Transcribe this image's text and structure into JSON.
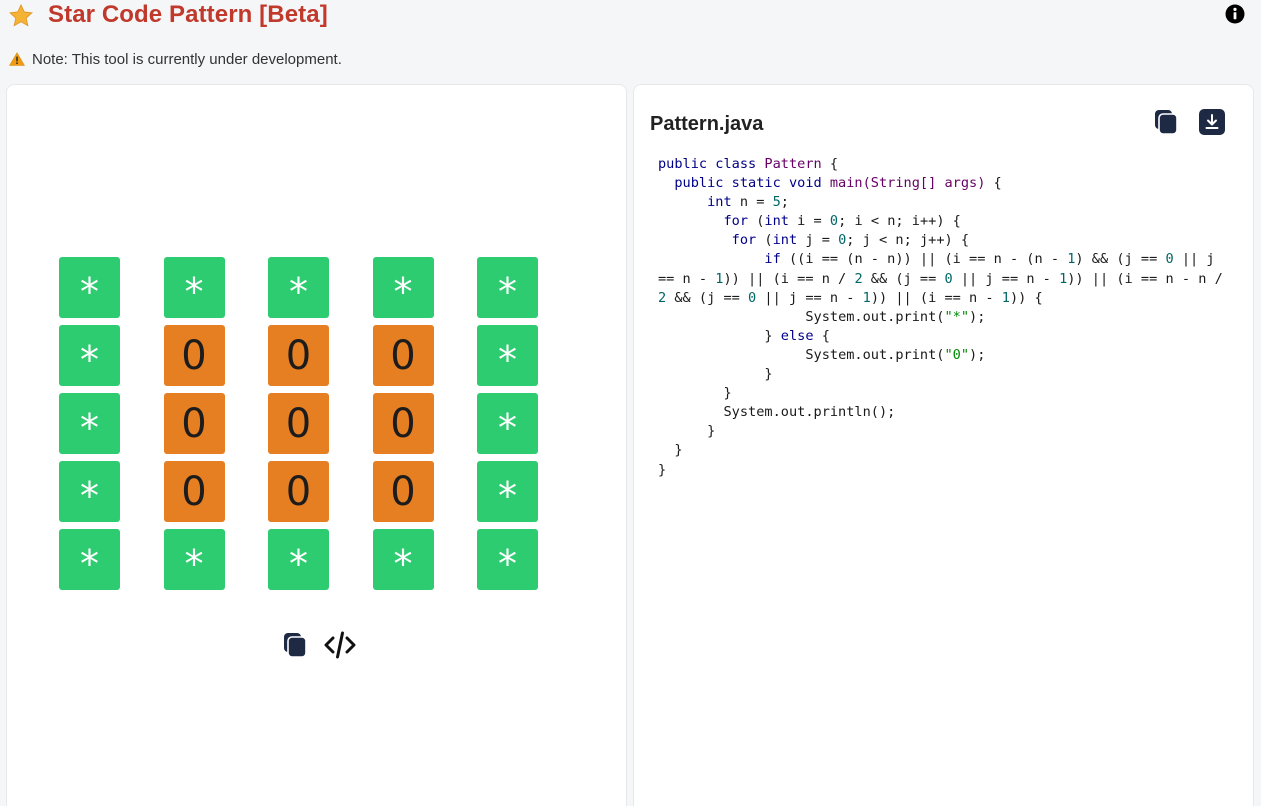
{
  "header": {
    "title": "Star Code Pattern [Beta]",
    "star_icon": "star-icon",
    "info_icon": "info-icon"
  },
  "note": {
    "text": "Note: This tool is currently under development.",
    "icon": "warning-icon"
  },
  "pattern": {
    "rows": [
      [
        "*",
        "*",
        "*",
        "*",
        "*"
      ],
      [
        "*",
        "0",
        "0",
        "0",
        "*"
      ],
      [
        "*",
        "0",
        "0",
        "0",
        "*"
      ],
      [
        "*",
        "0",
        "0",
        "0",
        "*"
      ],
      [
        "*",
        "*",
        "*",
        "*",
        "*"
      ]
    ],
    "star_color": "#2ecc71",
    "zero_color": "#e67e22"
  },
  "left_actions": {
    "copy_icon": "copy-icon",
    "code_icon": "code-icon"
  },
  "code_panel": {
    "filename": "Pattern.java",
    "copy_icon": "copy-icon",
    "download_icon": "download-icon",
    "lines": [
      [
        {
          "t": "public class ",
          "c": "kw"
        },
        {
          "t": "Pattern",
          "c": "cls"
        },
        {
          "t": " {",
          "c": ""
        }
      ],
      [
        {
          "t": "  public static void ",
          "c": "kw"
        },
        {
          "t": "main(String[] args)",
          "c": "cls"
        },
        {
          "t": " {",
          "c": ""
        }
      ],
      [
        {
          "t": "      int ",
          "c": "kw"
        },
        {
          "t": "n = ",
          "c": ""
        },
        {
          "t": "5",
          "c": "num"
        },
        {
          "t": ";",
          "c": ""
        }
      ],
      [
        {
          "t": "        for ",
          "c": "kw"
        },
        {
          "t": "(",
          "c": ""
        },
        {
          "t": "int ",
          "c": "kw"
        },
        {
          "t": "i = ",
          "c": ""
        },
        {
          "t": "0",
          "c": "num"
        },
        {
          "t": "; i < n; i++) {",
          "c": ""
        }
      ],
      [
        {
          "t": "         for ",
          "c": "kw"
        },
        {
          "t": "(",
          "c": ""
        },
        {
          "t": "int ",
          "c": "kw"
        },
        {
          "t": "j = ",
          "c": ""
        },
        {
          "t": "0",
          "c": "num"
        },
        {
          "t": "; j < n; j++) {",
          "c": ""
        }
      ],
      [
        {
          "t": "             if ",
          "c": "kw"
        },
        {
          "t": "((i == (n - n)) || (i == n - (n - ",
          "c": ""
        },
        {
          "t": "1",
          "c": "num"
        },
        {
          "t": ") && (j == ",
          "c": ""
        },
        {
          "t": "0",
          "c": "num"
        },
        {
          "t": " || j == n - ",
          "c": ""
        },
        {
          "t": "1",
          "c": "num"
        },
        {
          "t": ")) || (i == n / ",
          "c": ""
        },
        {
          "t": "2",
          "c": "num"
        },
        {
          "t": " && (j == ",
          "c": ""
        },
        {
          "t": "0",
          "c": "num"
        },
        {
          "t": " || j == n - ",
          "c": ""
        },
        {
          "t": "1",
          "c": "num"
        },
        {
          "t": ")) || (i == n - n / ",
          "c": ""
        },
        {
          "t": "2",
          "c": "num"
        },
        {
          "t": " && (j == ",
          "c": ""
        },
        {
          "t": "0",
          "c": "num"
        },
        {
          "t": " || j == n - ",
          "c": ""
        },
        {
          "t": "1",
          "c": "num"
        },
        {
          "t": ")) || (i == n - ",
          "c": ""
        },
        {
          "t": "1",
          "c": "num"
        },
        {
          "t": ")) {",
          "c": ""
        }
      ],
      [
        {
          "t": "                  System.out.print(",
          "c": ""
        },
        {
          "t": "\"*\"",
          "c": "str"
        },
        {
          "t": ");",
          "c": ""
        }
      ],
      [
        {
          "t": "             } ",
          "c": ""
        },
        {
          "t": "else",
          "c": "kw"
        },
        {
          "t": " {",
          "c": ""
        }
      ],
      [
        {
          "t": "                  System.out.print(",
          "c": ""
        },
        {
          "t": "\"0\"",
          "c": "str"
        },
        {
          "t": ");",
          "c": ""
        }
      ],
      [
        {
          "t": "             }",
          "c": ""
        }
      ],
      [
        {
          "t": "        }",
          "c": ""
        }
      ],
      [
        {
          "t": "        System.out.println();",
          "c": ""
        }
      ],
      [
        {
          "t": "      }",
          "c": ""
        }
      ],
      [
        {
          "t": "  }",
          "c": ""
        }
      ],
      [
        {
          "t": "}",
          "c": ""
        }
      ]
    ]
  }
}
